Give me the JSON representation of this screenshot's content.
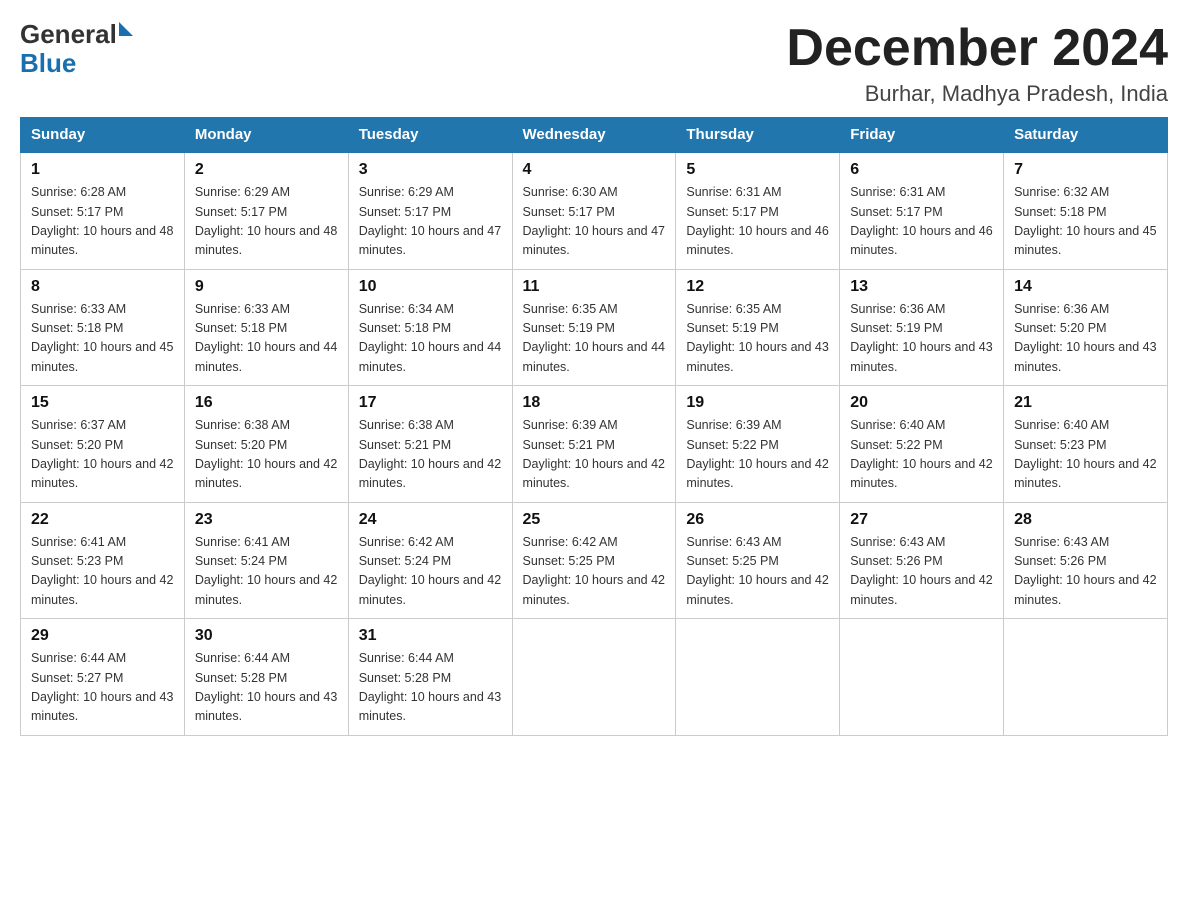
{
  "header": {
    "logo_general": "General",
    "logo_blue": "Blue",
    "month_title": "December 2024",
    "location": "Burhar, Madhya Pradesh, India"
  },
  "days_of_week": [
    "Sunday",
    "Monday",
    "Tuesday",
    "Wednesday",
    "Thursday",
    "Friday",
    "Saturday"
  ],
  "weeks": [
    [
      {
        "day": "1",
        "sunrise": "6:28 AM",
        "sunset": "5:17 PM",
        "daylight": "10 hours and 48 minutes."
      },
      {
        "day": "2",
        "sunrise": "6:29 AM",
        "sunset": "5:17 PM",
        "daylight": "10 hours and 48 minutes."
      },
      {
        "day": "3",
        "sunrise": "6:29 AM",
        "sunset": "5:17 PM",
        "daylight": "10 hours and 47 minutes."
      },
      {
        "day": "4",
        "sunrise": "6:30 AM",
        "sunset": "5:17 PM",
        "daylight": "10 hours and 47 minutes."
      },
      {
        "day": "5",
        "sunrise": "6:31 AM",
        "sunset": "5:17 PM",
        "daylight": "10 hours and 46 minutes."
      },
      {
        "day": "6",
        "sunrise": "6:31 AM",
        "sunset": "5:17 PM",
        "daylight": "10 hours and 46 minutes."
      },
      {
        "day": "7",
        "sunrise": "6:32 AM",
        "sunset": "5:18 PM",
        "daylight": "10 hours and 45 minutes."
      }
    ],
    [
      {
        "day": "8",
        "sunrise": "6:33 AM",
        "sunset": "5:18 PM",
        "daylight": "10 hours and 45 minutes."
      },
      {
        "day": "9",
        "sunrise": "6:33 AM",
        "sunset": "5:18 PM",
        "daylight": "10 hours and 44 minutes."
      },
      {
        "day": "10",
        "sunrise": "6:34 AM",
        "sunset": "5:18 PM",
        "daylight": "10 hours and 44 minutes."
      },
      {
        "day": "11",
        "sunrise": "6:35 AM",
        "sunset": "5:19 PM",
        "daylight": "10 hours and 44 minutes."
      },
      {
        "day": "12",
        "sunrise": "6:35 AM",
        "sunset": "5:19 PM",
        "daylight": "10 hours and 43 minutes."
      },
      {
        "day": "13",
        "sunrise": "6:36 AM",
        "sunset": "5:19 PM",
        "daylight": "10 hours and 43 minutes."
      },
      {
        "day": "14",
        "sunrise": "6:36 AM",
        "sunset": "5:20 PM",
        "daylight": "10 hours and 43 minutes."
      }
    ],
    [
      {
        "day": "15",
        "sunrise": "6:37 AM",
        "sunset": "5:20 PM",
        "daylight": "10 hours and 42 minutes."
      },
      {
        "day": "16",
        "sunrise": "6:38 AM",
        "sunset": "5:20 PM",
        "daylight": "10 hours and 42 minutes."
      },
      {
        "day": "17",
        "sunrise": "6:38 AM",
        "sunset": "5:21 PM",
        "daylight": "10 hours and 42 minutes."
      },
      {
        "day": "18",
        "sunrise": "6:39 AM",
        "sunset": "5:21 PM",
        "daylight": "10 hours and 42 minutes."
      },
      {
        "day": "19",
        "sunrise": "6:39 AM",
        "sunset": "5:22 PM",
        "daylight": "10 hours and 42 minutes."
      },
      {
        "day": "20",
        "sunrise": "6:40 AM",
        "sunset": "5:22 PM",
        "daylight": "10 hours and 42 minutes."
      },
      {
        "day": "21",
        "sunrise": "6:40 AM",
        "sunset": "5:23 PM",
        "daylight": "10 hours and 42 minutes."
      }
    ],
    [
      {
        "day": "22",
        "sunrise": "6:41 AM",
        "sunset": "5:23 PM",
        "daylight": "10 hours and 42 minutes."
      },
      {
        "day": "23",
        "sunrise": "6:41 AM",
        "sunset": "5:24 PM",
        "daylight": "10 hours and 42 minutes."
      },
      {
        "day": "24",
        "sunrise": "6:42 AM",
        "sunset": "5:24 PM",
        "daylight": "10 hours and 42 minutes."
      },
      {
        "day": "25",
        "sunrise": "6:42 AM",
        "sunset": "5:25 PM",
        "daylight": "10 hours and 42 minutes."
      },
      {
        "day": "26",
        "sunrise": "6:43 AM",
        "sunset": "5:25 PM",
        "daylight": "10 hours and 42 minutes."
      },
      {
        "day": "27",
        "sunrise": "6:43 AM",
        "sunset": "5:26 PM",
        "daylight": "10 hours and 42 minutes."
      },
      {
        "day": "28",
        "sunrise": "6:43 AM",
        "sunset": "5:26 PM",
        "daylight": "10 hours and 42 minutes."
      }
    ],
    [
      {
        "day": "29",
        "sunrise": "6:44 AM",
        "sunset": "5:27 PM",
        "daylight": "10 hours and 43 minutes."
      },
      {
        "day": "30",
        "sunrise": "6:44 AM",
        "sunset": "5:28 PM",
        "daylight": "10 hours and 43 minutes."
      },
      {
        "day": "31",
        "sunrise": "6:44 AM",
        "sunset": "5:28 PM",
        "daylight": "10 hours and 43 minutes."
      },
      null,
      null,
      null,
      null
    ]
  ]
}
